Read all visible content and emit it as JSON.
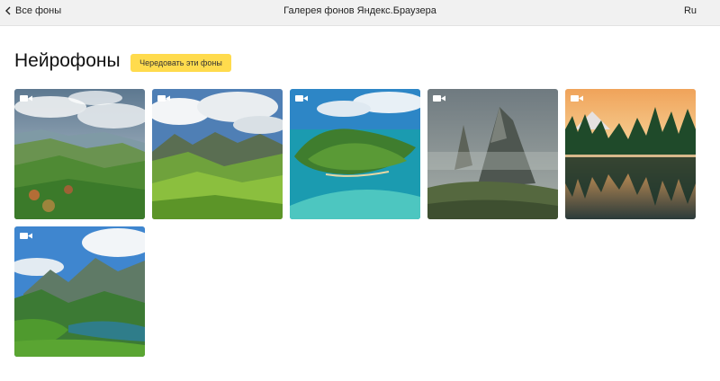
{
  "topbar": {
    "back_label": "Все фоны",
    "title": "Галерея фонов Яндекс.Браузера",
    "lang": "Ru"
  },
  "section": {
    "title": "Нейрофоны",
    "alternate_button": "Чередовать эти фоны"
  },
  "colors": {
    "accent_button": "#ffdb4d",
    "topbar_bg": "#f1f1f1"
  },
  "gallery": [
    {
      "subject": "green valley with clouds",
      "icon": "video-icon"
    },
    {
      "subject": "mountain meadow with white clouds",
      "icon": "video-icon"
    },
    {
      "subject": "tropical island in turquoise sea",
      "icon": "video-icon"
    },
    {
      "subject": "misty rocky mountain peaks",
      "icon": "video-icon"
    },
    {
      "subject": "forest lake at sunset",
      "icon": "video-icon"
    },
    {
      "subject": "mountain lake with blue sky",
      "icon": "video-icon"
    }
  ]
}
